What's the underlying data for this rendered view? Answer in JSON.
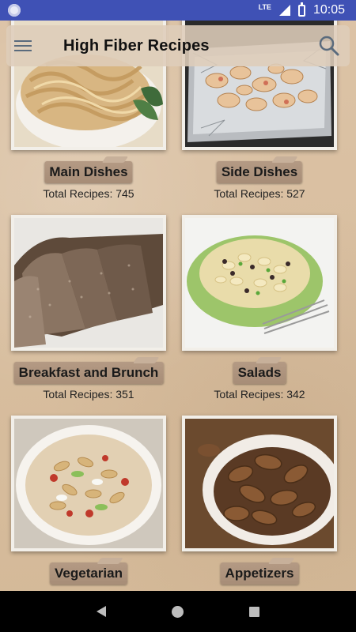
{
  "status_bar": {
    "network": "LTE",
    "time": "10:05"
  },
  "toolbar": {
    "title": "High Fiber Recipes",
    "menu_icon": "hamburger-menu-icon",
    "search_icon": "search-icon"
  },
  "categories": [
    {
      "label": "Main Dishes",
      "count_text": "Total Recipes: 745",
      "image": "pasta-fettuccine"
    },
    {
      "label": "Side Dishes",
      "count_text": "Total Recipes: 527",
      "image": "roasted-potatoes-foil"
    },
    {
      "label": "Breakfast and Brunch",
      "count_text": "Total Recipes: 351",
      "image": "whole-wheat-bread"
    },
    {
      "label": "Salads",
      "count_text": "Total Recipes: 342",
      "image": "pasta-salad"
    },
    {
      "label": "Vegetarian",
      "count_text": "",
      "image": "rotini-pasta-dish"
    },
    {
      "label": "Appetizers",
      "count_text": "",
      "image": "boiled-peanuts-bowl"
    }
  ],
  "colors": {
    "status_bar": "#3f51b5",
    "background": "#d9c0a3",
    "label_plate": "#ad9380"
  },
  "nav_bar": {
    "back_icon": "back-triangle-icon",
    "home_icon": "home-circle-icon",
    "recents_icon": "recents-square-icon"
  }
}
